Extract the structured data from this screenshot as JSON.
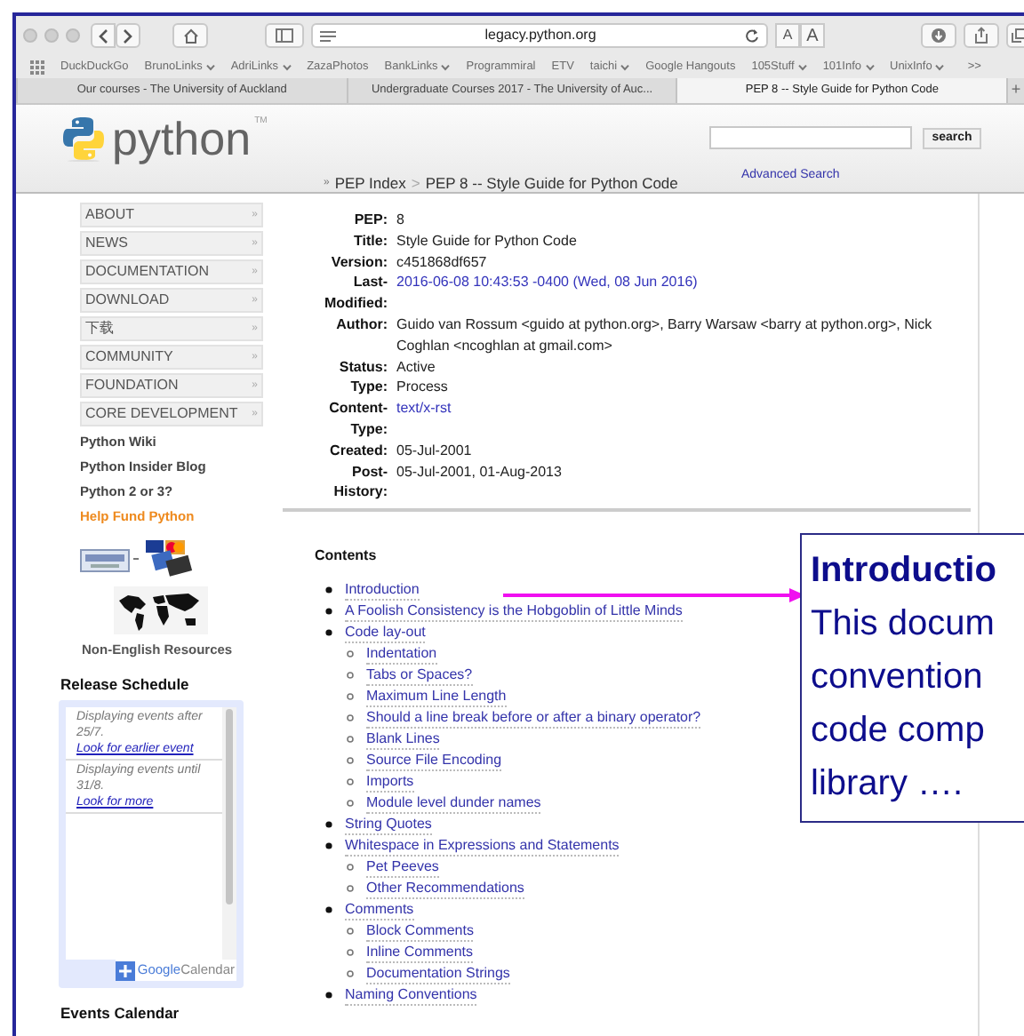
{
  "browser": {
    "address": "legacy.python.org",
    "text_size_buttons": [
      "A",
      "A"
    ],
    "bookmarks": [
      {
        "label": "DuckDuckGo",
        "menu": false
      },
      {
        "label": "BrunoLinks",
        "menu": true
      },
      {
        "label": "AdriLinks",
        "menu": true
      },
      {
        "label": "ZazaPhotos",
        "menu": false
      },
      {
        "label": "BankLinks",
        "menu": true
      },
      {
        "label": "Programmiral",
        "menu": false
      },
      {
        "label": "ETV",
        "menu": false
      },
      {
        "label": "taichi",
        "menu": true
      },
      {
        "label": "Google Hangouts",
        "menu": false
      },
      {
        "label": "105Stuff",
        "menu": true
      },
      {
        "label": "101Info",
        "menu": true
      },
      {
        "label": "UnixInfo",
        "menu": true
      }
    ],
    "bookmarks_more": ">>",
    "tabs": [
      {
        "label": "Our courses - The University of Auckland",
        "selected": false
      },
      {
        "label": "Undergraduate Courses 2017 - The University of Auc...",
        "selected": false
      },
      {
        "label": "PEP 8 -- Style Guide for Python Code",
        "selected": true
      }
    ],
    "new_tab": "+"
  },
  "header": {
    "logo_text": "python",
    "logo_tm": "TM",
    "search_button": "search",
    "advanced_search": "Advanced Search",
    "breadcrumb": {
      "marker": "»",
      "items": [
        "PEP Index",
        "PEP 8 -- Style Guide for Python Code"
      ],
      "separator": ">"
    }
  },
  "sidebar": {
    "nav": [
      {
        "label": "ABOUT",
        "marker": "»"
      },
      {
        "label": "NEWS",
        "marker": "»"
      },
      {
        "label": "DOCUMENTATION",
        "marker": "»"
      },
      {
        "label": "DOWNLOAD",
        "marker": "»"
      },
      {
        "label": "下载",
        "marker": "»"
      },
      {
        "label": "COMMUNITY",
        "marker": "»"
      },
      {
        "label": "FOUNDATION",
        "marker": "»"
      },
      {
        "label": "CORE DEVELOPMENT",
        "marker": "»"
      }
    ],
    "links": [
      {
        "label": "Python Wiki",
        "kind": "plain"
      },
      {
        "label": "Python Insider Blog",
        "kind": "plain"
      },
      {
        "label": "Python 2 or 3?",
        "kind": "plain"
      },
      {
        "label": "Help Fund Python",
        "kind": "highlight"
      }
    ],
    "non_english": "Non-English Resources",
    "release_schedule": {
      "title": "Release Schedule",
      "entries": [
        {
          "text": "Displaying events after 25/7.",
          "link": "Look for earlier event"
        },
        {
          "text": "Displaying events until 31/8.",
          "link": "Look for more"
        }
      ],
      "calendar_button": {
        "google": "Google",
        "calendar": "Calendar"
      }
    },
    "events_title": "Events Calendar"
  },
  "pep": {
    "fields": [
      {
        "label": "PEP:",
        "value": "8",
        "kind": "text"
      },
      {
        "label": "Title:",
        "value": "Style Guide for Python Code",
        "kind": "text"
      },
      {
        "label": "Version:",
        "value": "c451868df657",
        "kind": "text"
      },
      {
        "label": "Last-Modified:",
        "value": "2016-06-08 10:43:53 -0400 (Wed, 08 Jun 2016)",
        "kind": "link"
      },
      {
        "label": "Author:",
        "value": "Guido van Rossum <guido at python.org>, Barry Warsaw <barry at python.org>, Nick Coghlan <ncoghlan at gmail.com>",
        "kind": "text"
      },
      {
        "label": "Status:",
        "value": "Active",
        "kind": "text"
      },
      {
        "label": "Type:",
        "value": "Process",
        "kind": "text"
      },
      {
        "label": "Content-Type:",
        "value": "text/x-rst",
        "kind": "link"
      },
      {
        "label": "Created:",
        "value": "05-Jul-2001",
        "kind": "text"
      },
      {
        "label": "Post-History:",
        "value": "05-Jul-2001, 01-Aug-2013",
        "kind": "text"
      }
    ],
    "contents_title": "Contents",
    "contents": [
      {
        "label": "Introduction"
      },
      {
        "label": "A Foolish Consistency is the Hobgoblin of Little Minds"
      },
      {
        "label": "Code lay-out",
        "children": [
          {
            "label": "Indentation"
          },
          {
            "label": "Tabs or Spaces?"
          },
          {
            "label": "Maximum Line Length"
          },
          {
            "label": "Should a line break before or after a binary operator?"
          },
          {
            "label": "Blank Lines"
          },
          {
            "label": "Source File Encoding"
          },
          {
            "label": "Imports"
          },
          {
            "label": "Module level dunder names"
          }
        ]
      },
      {
        "label": "String Quotes"
      },
      {
        "label": "Whitespace in Expressions and Statements",
        "children": [
          {
            "label": "Pet Peeves"
          },
          {
            "label": "Other Recommendations"
          }
        ]
      },
      {
        "label": "Comments",
        "children": [
          {
            "label": "Block Comments"
          },
          {
            "label": "Inline Comments"
          },
          {
            "label": "Documentation Strings"
          }
        ]
      },
      {
        "label": "Naming Conventions"
      }
    ]
  },
  "callout": {
    "title": "Introductio",
    "lines": [
      "This docum",
      "convention",
      "code comp",
      "library …."
    ]
  }
}
